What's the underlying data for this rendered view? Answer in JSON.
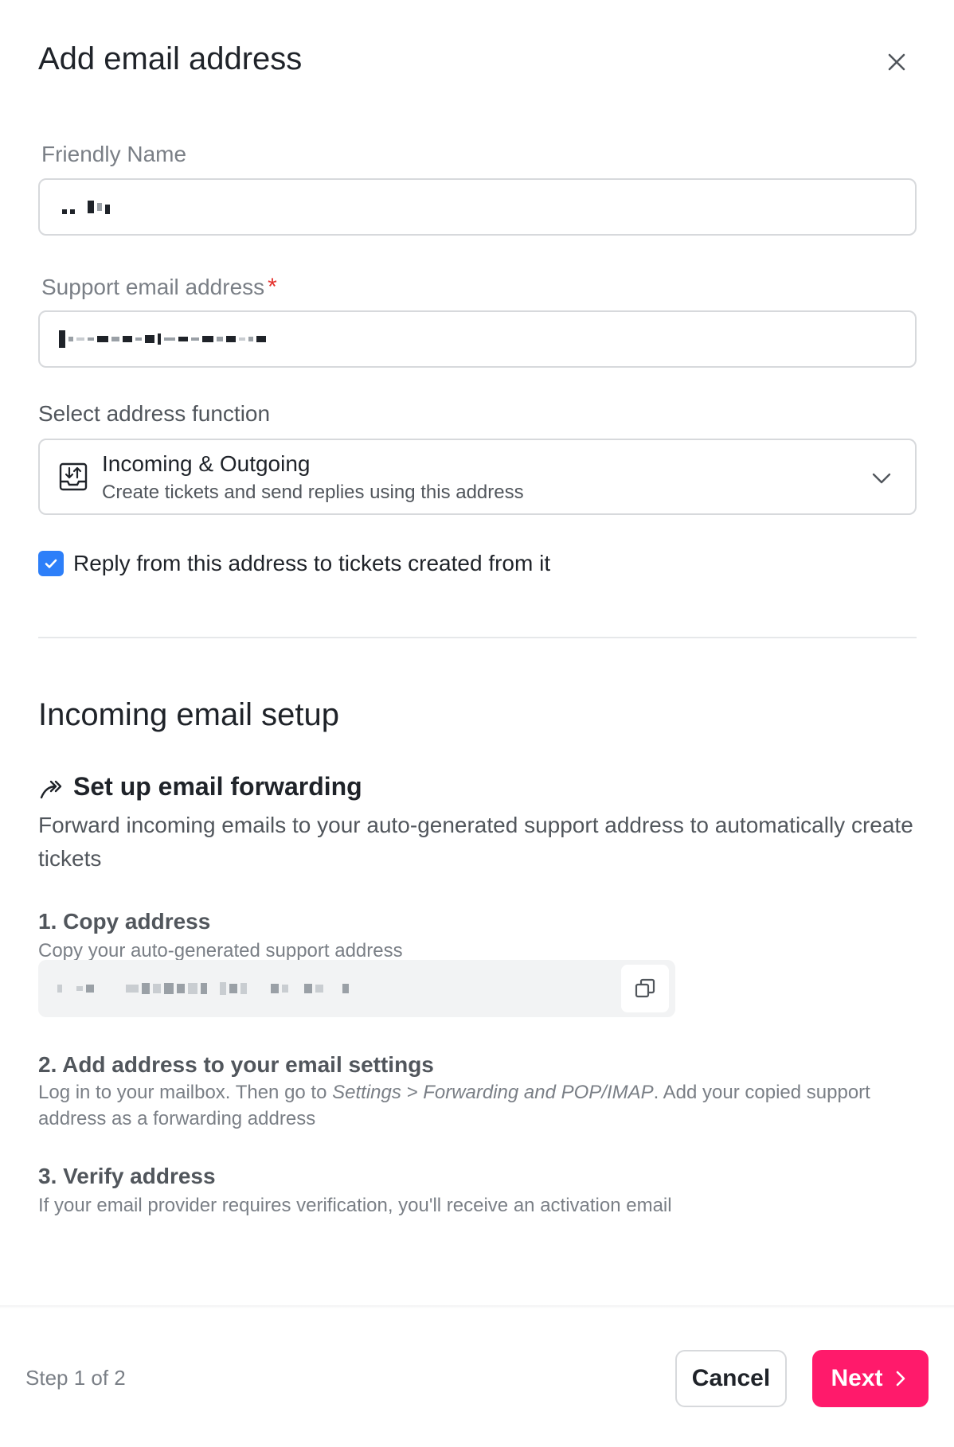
{
  "dialog": {
    "title": "Add email address",
    "close_icon": "close-icon"
  },
  "form": {
    "friendly_name": {
      "label": "Friendly Name",
      "value": "[redacted]"
    },
    "support_email": {
      "label": "Support email address",
      "required_mark": "*",
      "value": "[redacted]"
    },
    "address_function": {
      "label": "Select address function",
      "selected_title": "Incoming & Outgoing",
      "selected_description": "Create tickets and send replies using this address",
      "icon": "inbox-transfer-icon"
    },
    "reply_checkbox": {
      "label": "Reply from this address to tickets created from it",
      "checked": true
    }
  },
  "incoming": {
    "title": "Incoming email setup",
    "forwarding": {
      "title": "Set up email forwarding",
      "description": "Forward incoming emails to your auto-generated support address to automatically create tickets",
      "icon": "forward-icon"
    },
    "steps": [
      {
        "title": "1. Copy address",
        "description": "Copy your auto-generated support address",
        "value": "[redacted]"
      },
      {
        "title": "2. Add address to your email settings",
        "description_prefix": "Log in to your mailbox. Then go to ",
        "description_em": "Settings > Forwarding and POP/IMAP",
        "description_suffix": ". Add your copied support address as a forwarding address"
      },
      {
        "title": "3. Verify address",
        "description": "If your email provider requires verification, you'll receive an activation email"
      }
    ]
  },
  "footer": {
    "step_info": "Step 1 of 2",
    "cancel_label": "Cancel",
    "next_label": "Next"
  },
  "colors": {
    "accent": "#ff1a6b",
    "checkbox": "#2d7ff9",
    "required": "#e5322d"
  }
}
